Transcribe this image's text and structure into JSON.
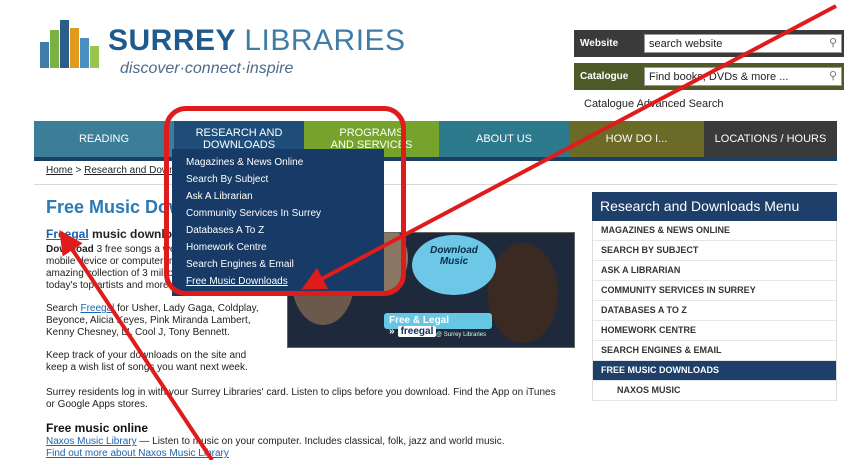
{
  "brand": {
    "name_bold": "SURREY",
    "name_light": "LIBRARIES",
    "tagline": "discover·connect·inspire",
    "bar_colors": [
      "#3f7ca8",
      "#79b142",
      "#e29a1c",
      "#2b5d8a",
      "#4a8fc4",
      "#99c54d"
    ]
  },
  "search": {
    "website_label": "Website",
    "website_value": "search website",
    "catalogue_label": "Catalogue",
    "catalogue_value": "Find books, DVDs & more ...",
    "advanced_link": "Catalogue Advanced Search"
  },
  "nav": [
    {
      "label": "READING",
      "color": "#3c7e97"
    },
    {
      "label": "RESEARCH AND DOWNLOADS",
      "color": "#1f4d7a"
    },
    {
      "label": "PROGRAMS AND SERVICES",
      "color": "#75a32c"
    },
    {
      "label": "ABOUT US",
      "color": "#2d7a8c"
    },
    {
      "label": "HOW DO I...",
      "color": "#6b6a26"
    },
    {
      "label": "LOCATIONS / HOURS",
      "color": "#3a3a3a"
    }
  ],
  "breadcrumb": {
    "home": "Home",
    "separator": ">",
    "current": "Research and Downloads"
  },
  "dropdown": {
    "items": [
      "Magazines & News Online",
      "Search By Subject",
      "Ask A Librarian",
      "Community Services In Surrey",
      "Databases A To Z",
      "Homework Centre",
      "Search Engines & Email",
      "Free Music Downloads"
    ]
  },
  "main": {
    "title": "Free Music Downloads",
    "freegal_link": "Freegal",
    "freegal_heading_rest": "music downloads",
    "intro_bold": "Download",
    "intro_line1": "3 free songs a week to your",
    "intro_line2": "mobile device or computer from an",
    "intro_line3": "amazing collection of 3 million songs by",
    "intro_line4": "today's top artists and more.",
    "search_pre": "Search",
    "search_link": "Freegal",
    "search_line1_rest": "for Usher, Lady Gaga, Coldplay,",
    "search_line2": "Beyonce, Alicia Keyes, Pink  Miranda Lambert,",
    "search_line3": "Kenny Chesney, LL Cool J, Tony Bennett.",
    "track_line1": "Keep track of your downloads on the site and",
    "track_line2": "keep a wish list of songs you want next week.",
    "residents_line1": "Surrey residents log in with your Surrey Libraries' card. Listen to clips before you download. Find the App on iTunes",
    "residents_line2": "or Google Apps stores.",
    "online_heading": "Free music online",
    "naxos_link": "Naxos Music Library",
    "naxos_rest": "— Listen to music on your computer. Includes classical, folk, jazz and world music.",
    "naxos_more": "Find out more about Naxos Music Library"
  },
  "promo": {
    "badge_line1": "Download",
    "badge_line2": "Music",
    "pill_text": "Free & Legal »",
    "pill_brand": "freegal",
    "powered": "@ Surrey Libraries"
  },
  "sidebar": {
    "title": "Research and Downloads Menu",
    "items": [
      {
        "label": "MAGAZINES & NEWS ONLINE",
        "state": "normal"
      },
      {
        "label": "SEARCH BY SUBJECT",
        "state": "normal"
      },
      {
        "label": "ASK A LIBRARIAN",
        "state": "normal"
      },
      {
        "label": "COMMUNITY SERVICES IN SURREY",
        "state": "normal"
      },
      {
        "label": "DATABASES A TO Z",
        "state": "normal"
      },
      {
        "label": "HOMEWORK CENTRE",
        "state": "normal"
      },
      {
        "label": "SEARCH ENGINES & EMAIL",
        "state": "normal"
      },
      {
        "label": "FREE MUSIC DOWNLOADS",
        "state": "active"
      },
      {
        "label": "NAXOS MUSIC",
        "state": "sub"
      }
    ]
  },
  "annotation": {
    "color": "#e01b1b"
  }
}
